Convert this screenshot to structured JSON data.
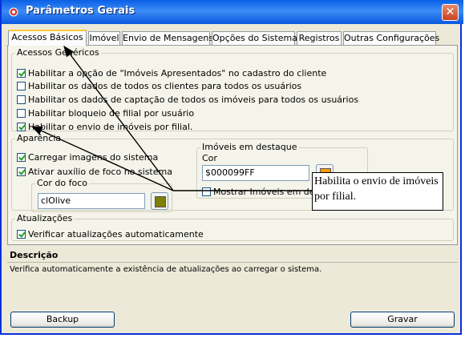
{
  "window": {
    "title": "Parâmetros Gerais",
    "close_glyph": "✕",
    "icon": "settings-icon"
  },
  "tabs": [
    {
      "label": "Acessos Básicos",
      "active": true
    },
    {
      "label": "Imóvel",
      "active": false
    },
    {
      "label": "Envio de Mensagens",
      "active": false
    },
    {
      "label": "Opções do Sistema",
      "active": false
    },
    {
      "label": "Registros",
      "active": false
    },
    {
      "label": "Outras Configurações",
      "active": false
    }
  ],
  "acessos_genericos": {
    "legend": "Acessos Genéricos",
    "options": [
      {
        "label": "Habilitar a opção de \"Imóveis Apresentados\" no cadastro do cliente",
        "checked": true
      },
      {
        "label": "Habilitar os dados de todos os clientes para todos os usuários",
        "checked": false
      },
      {
        "label": "Habilitar os dados de captação de todos os imóveis para todos os usuários",
        "checked": false
      },
      {
        "label": "Habilitar bloqueio de filial por usuário",
        "checked": false
      },
      {
        "label": "Habilitar o envio de imóveis por filial.",
        "checked": true
      }
    ]
  },
  "aparencia": {
    "legend": "Aparência",
    "carregar_imagens": {
      "label": "Carregar imagens do sistema",
      "checked": true
    },
    "ativar_foco": {
      "label": "Ativar auxílio de foco no sistema",
      "checked": true
    },
    "cor_do_foco": {
      "legend": "Cor do foco",
      "value": "clOlive",
      "swatch": "#808000"
    },
    "imoveis_destaque": {
      "legend": "Imóveis em destaque",
      "cor_label": "Cor",
      "value": "$000099FF",
      "swatch": "#ff9900",
      "mostrar": {
        "label": "Mostrar Imóveis em destaq",
        "checked": false
      }
    }
  },
  "atualizacoes": {
    "legend": "Atualizações",
    "verificar": {
      "label": "Verificar atualizações automaticamente",
      "checked": true
    }
  },
  "descricao": {
    "title": "Descrição",
    "text": "Verifica automaticamente a existência de atualizações ao carregar o sistema."
  },
  "buttons": {
    "backup": "Backup",
    "gravar": "Gravar"
  },
  "callout": {
    "text": "Habilita o envio de imóveis por filial."
  },
  "colors": {
    "titlebar": "#0a5fe6",
    "panel": "#ece9d8",
    "check": "#21a121",
    "arrow": "#000000"
  }
}
